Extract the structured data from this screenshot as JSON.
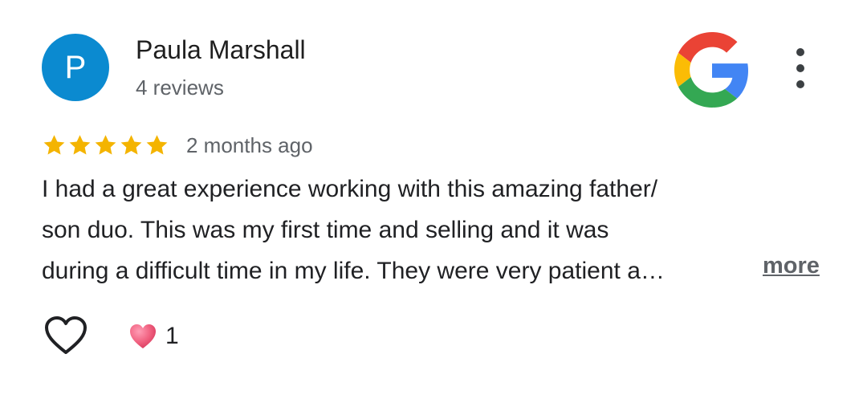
{
  "reviewer": {
    "avatar_letter": "P",
    "avatar_color": "#0b8ad0",
    "name": "Paula Marshall",
    "review_count": "4 reviews"
  },
  "source": {
    "icon": "google-g-logo"
  },
  "menu": {
    "icon": "more-vert-icon"
  },
  "review": {
    "rating": 5,
    "rating_max": 5,
    "star_color": "#f4b400",
    "age": "2 months ago",
    "text_lines": [
      "I had a great experience working with this amazing father/",
      "son duo. This was my first time and selling and it was",
      "during a difficult time in my life. They were very patient a…"
    ],
    "more_label": "more"
  },
  "actions": {
    "like_icon": "heart-outline-icon",
    "reaction_icon": "heart-emoji-icon",
    "reaction_count": "1"
  }
}
